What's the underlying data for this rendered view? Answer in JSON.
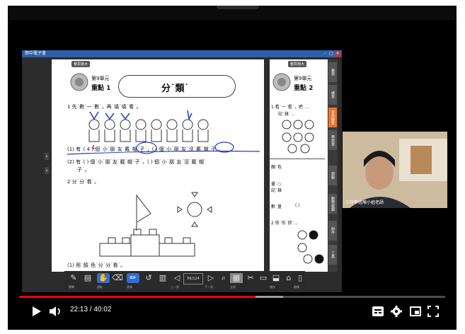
{
  "window": {
    "title": "簡中電子書"
  },
  "left_page": {
    "header_tag": "整頁放大",
    "unit": "第9單元",
    "point": "重點 1",
    "title": "分˙類˙",
    "q1": "1  先˙數˙一˙數˙，再˙填˙填˙看˙。",
    "line1": "(1) 有˙( 4 ) 個˙小˙朋˙友˙戴˙帽˙子˙，(    ) 個˙小˙朋˙友˙沒˙戴˙帽˙子˙。",
    "line2": "(2) 有˙(    ) 個˙小˙朋˙友˙戴˙帽˙子˙，(    ) 個˙小˙朋˙友˙沒˙戴˙帽˙",
    "line2b": "子˙。",
    "q2": "2  分˙分˙看˙。",
    "q3": "(1) 用˙顏˙色˙分˙分˙看˙。"
  },
  "right_page": {
    "header_tag": "整頁放大",
    "unit": "第9單元",
    "point": "重點 2",
    "q1": "1  看˙一˙看˙，把˙...",
    "q1b": "記˙錄˙...",
    "row1": "顏˙色",
    "row2": "畫˙○\n記˙錄",
    "row3": "數˙量",
    "row3val": "(    )",
    "q2": "2  依˙形˙狀˙..."
  },
  "side_tabs": [
    "複習",
    "練習",
    "習作解答",
    "學習單",
    "測驗",
    "數學遊戲",
    "附件",
    "工具"
  ],
  "toolbar": {
    "captions": [
      "畫筆",
      "螢光筆",
      "選取",
      "橡皮擦",
      "直線",
      "上一頁",
      "頁碼",
      "下一頁",
      "放大",
      "全頁",
      "裁切",
      "白板",
      "儲存",
      "工具箱",
      "離開"
    ],
    "page_indicator": "56/124"
  },
  "webcam": {
    "name": "三年甲班陳小姐老師"
  },
  "player": {
    "current_time": "22:13",
    "duration": "40:02",
    "time_display": "22:13 / 40:02",
    "progress": 0.555,
    "loaded": 0.62,
    "accent": "#ff0000"
  },
  "icons": [
    "play-icon",
    "volume-icon",
    "subtitles-icon",
    "settings-icon",
    "miniplayer-icon",
    "fullscreen-icon"
  ]
}
